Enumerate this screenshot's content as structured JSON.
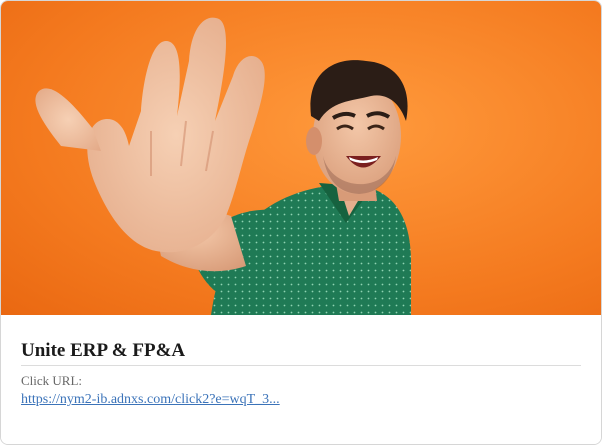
{
  "ad": {
    "title": "Unite ERP & FP&A",
    "click_url_label": "Click URL:",
    "click_url": "https://nym2-ib.adnxs.com/click2?e=wqT_3...",
    "image": {
      "subject": "smiling man waving hand",
      "background_color": "#f47a1f"
    }
  }
}
